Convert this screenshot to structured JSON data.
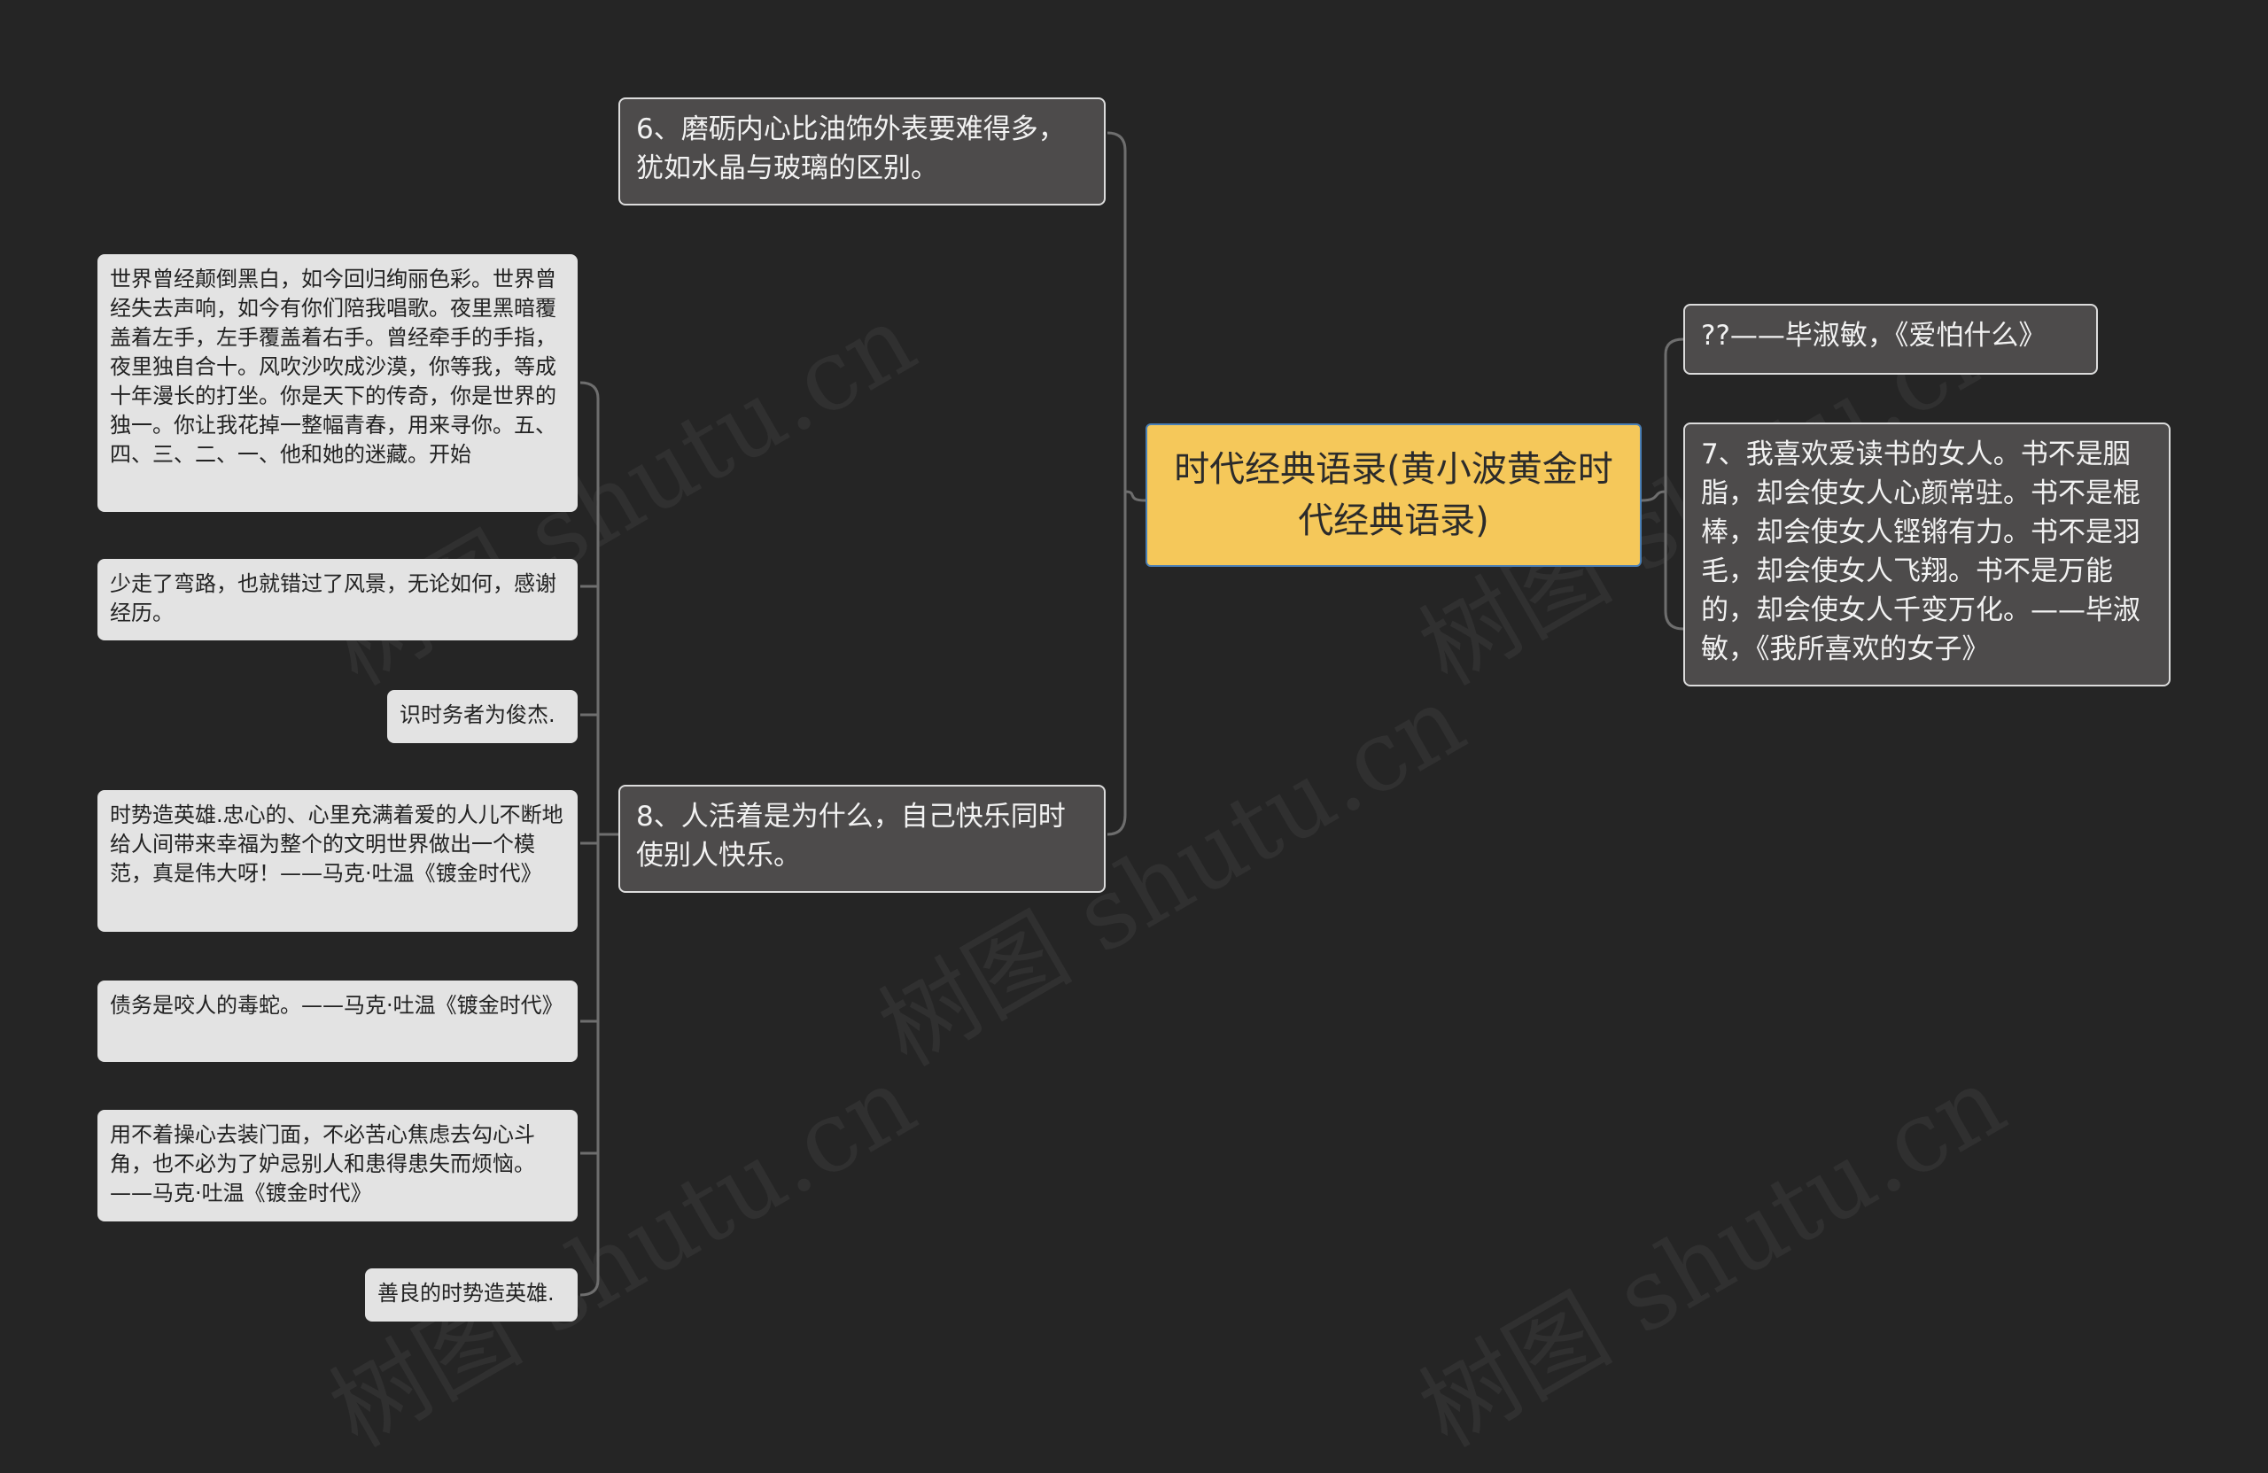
{
  "root": {
    "label": "时代经典语录(黄小波黄金时代经典语录)"
  },
  "branches": [
    {
      "label": "6、磨砺内心比油饰外表要难得多，犹如水晶与玻璃的区别。"
    },
    {
      "label": "8、人活着是为什么，自己快乐同时使别人快乐。"
    },
    {
      "label": "??——毕淑敏，《爱怕什么》"
    },
    {
      "label": "7、我喜欢爱读书的女人。书不是胭脂，却会使女人心颜常驻。书不是棍棒，却会使女人铿锵有力。书不是羽毛，却会使女人飞翔。书不是万能的，却会使女人千变万化。——毕淑敏，《我所喜欢的女子》"
    }
  ],
  "leaves": [
    {
      "label": "世界曾经颠倒黑白，如今回归绚丽色彩。世界曾经失去声响，如今有你们陪我唱歌。夜里黑暗覆盖着左手，左手覆盖着右手。曾经牵手的手指，夜里独自合十。风吹沙吹成沙漠，你等我，等成十年漫长的打坐。你是天下的传奇，你是世界的独一。你让我花掉一整幅青春，用来寻你。五、四、三、二、一、他和她的迷藏。开始"
    },
    {
      "label": "少走了弯路，也就错过了风景，无论如何，感谢经历。"
    },
    {
      "label": "识时务者为俊杰."
    },
    {
      "label": "时势造英雄.忠心的、心里充满着爱的人儿不断地给人间带来幸福为整个的文明世界做出一个模范，真是伟大呀！——马克·吐温《镀金时代》"
    },
    {
      "label": "债务是咬人的毒蛇。——马克·吐温《镀金时代》"
    },
    {
      "label": "用不着操心去装门面，不必苦心焦虑去勾心斗角，也不必为了妒忌别人和患得患失而烦恼。——马克·吐温《镀金时代》"
    },
    {
      "label": "善良的时势造英雄."
    }
  ],
  "watermarks": [
    "树图 shutu.cn",
    "树图 shutu.cn",
    "树图 shutu.cn",
    "树图 shutu.cn",
    "树图 shutu.cn"
  ],
  "colors": {
    "background": "#252525",
    "root_fill": "#f5c85a",
    "root_border": "#4a7fb5",
    "branch_fill": "#4d4b4b",
    "leaf_fill": "#e3e3e3",
    "connector": "#6e6e6e"
  }
}
